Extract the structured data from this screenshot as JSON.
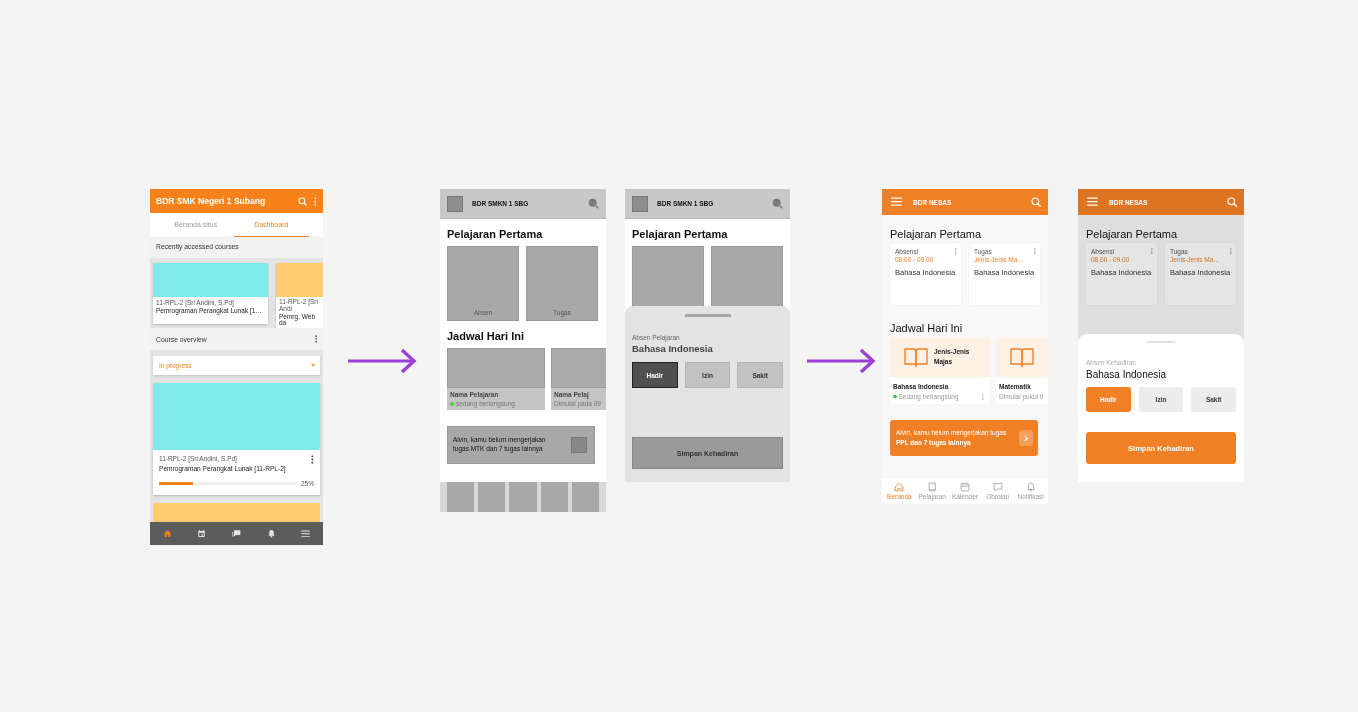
{
  "flow": [
    {
      "kind": "moodle",
      "app_bar": {
        "title": "BDR SMK Negeri 1 Subang"
      },
      "tabs": [
        {
          "label": "Beranda situs",
          "selected": false
        },
        {
          "label": "Dashboard",
          "selected": true
        }
      ],
      "recent_heading": "Recently accessed courses",
      "recent_courses": [
        {
          "color": "#7eeae9",
          "meta": "11-RPL-2 [Sri Andini, S.Pd]",
          "name": "Pemrograman Perangkat Lunak [1…"
        },
        {
          "color": "#fecb6f",
          "meta": "11-RPL-2 [Sri Andi",
          "name": "Pemrg. Web da"
        }
      ],
      "overview_heading": "Course overview",
      "filter": "In progress",
      "course": {
        "color": "#7eeae9",
        "meta": "11-RPL-2 [Sri Andini, S.Pd]",
        "name": "Pemrograman Perangkat Lunak [11-RPL-2]",
        "level": 0.25,
        "percent": "25%"
      },
      "next_course": {
        "color": "#fecb6f"
      },
      "nav": [
        {
          "kind": "home",
          "selected": true
        },
        {
          "kind": "calendar",
          "selected": false
        },
        {
          "kind": "messages",
          "selected": false
        },
        {
          "kind": "bell",
          "selected": false
        },
        {
          "kind": "menu",
          "selected": false
        }
      ]
    },
    {
      "kind": "arrow"
    },
    {
      "kind": "wire_home",
      "header": {
        "title": "BDR SMKN 1 SBG"
      },
      "section_1": "Pelajaran Pertama",
      "tiles": [
        "Absen",
        "Tugas"
      ],
      "section_2": "Jadwal Hari Ini",
      "schedule": [
        {
          "name": "Nama Pelajaran",
          "status": "sedang berlangsung",
          "live": true
        },
        {
          "name": "Nama Pelaj",
          "status": "Dimulai pada 09",
          "live": false
        }
      ],
      "reminder": "Alvin, kamu belum mengerjakan tugas MTK dan 7 tugas lainnya"
    },
    {
      "kind": "wire_sheet",
      "header": {
        "title": "BDR SMKN 1 SBG"
      },
      "section_1": "Pelajaran Pertama",
      "sheet": {
        "label": "Absen Pelajaran",
        "title": "Bahasa Indonesia",
        "options": [
          {
            "label": "Hadir",
            "selected": true
          },
          {
            "label": "Izin",
            "selected": false
          },
          {
            "label": "Sakit",
            "selected": false
          }
        ],
        "save": "Simpan Kehadiran"
      }
    },
    {
      "kind": "arrow"
    },
    {
      "kind": "final_home",
      "header": {
        "title": "BDR NESAS"
      },
      "section_1": "Pelajaran Pertama",
      "cards": [
        {
          "type": "Absensi",
          "detail": "08.00 - 09.00",
          "subject": "Bahasa Indonesia"
        },
        {
          "type": "Tugas",
          "detail": "Jenis-Jenis Ma...",
          "subject": "Bahasa Indonesia"
        }
      ],
      "section_2": "Jadwal Hari Ini",
      "schedule": [
        {
          "topic": "Jenis-Jenis Majas",
          "subject": "Bahasa Indonesia",
          "status": "Sedang berlangsung",
          "live": true
        },
        {
          "subject": "Matematik",
          "status": "Dimulai pukul 0",
          "live": false
        }
      ],
      "reminder": "Alvin, kamu belum mengerjakan tugas **PPL dan 7 tugas lainnya**",
      "nav": [
        {
          "kind": "home",
          "label": "Beranda",
          "selected": true
        },
        {
          "kind": "book",
          "label": "Pelajaran",
          "selected": false
        },
        {
          "kind": "calendar",
          "label": "Kalender",
          "selected": false
        },
        {
          "kind": "chat",
          "label": "Obrolan",
          "selected": false
        },
        {
          "kind": "bell",
          "label": "Notifikasi",
          "selected": false
        }
      ]
    },
    {
      "kind": "final_sheet",
      "header": {
        "title": "BDR NESAS"
      },
      "section_1": "Pelajaran Pertama",
      "cards": [
        {
          "type": "Absensi",
          "detail": "08.00 - 09.00",
          "subject": "Bahasa Indonesia"
        },
        {
          "type": "Tugas",
          "detail": "Jenis-Jenis Ma...",
          "subject": "Bahasa Indonesia"
        }
      ],
      "sheet": {
        "label": "Absen Kehadiran",
        "title": "Bahasa Indonesia",
        "options": [
          {
            "label": "Hadir",
            "selected": true
          },
          {
            "label": "Izin",
            "selected": false
          },
          {
            "label": "Sakit",
            "selected": false
          }
        ],
        "save": "Simpan Kehadiran"
      }
    }
  ]
}
